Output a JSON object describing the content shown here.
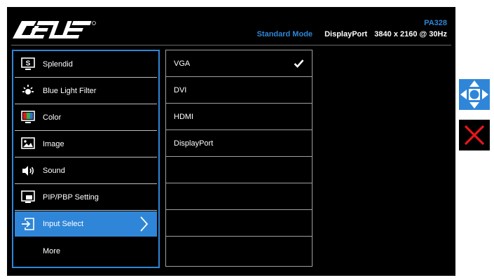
{
  "header": {
    "brand": "ASUS",
    "model": "PA328",
    "mode": "Standard Mode",
    "input": "DisplayPort",
    "resolution": "3840 x 2160 @ 30Hz"
  },
  "menu": {
    "items": [
      {
        "label": "Splendid",
        "icon": "splendid-icon"
      },
      {
        "label": "Blue Light Filter",
        "icon": "blue-light-filter-icon"
      },
      {
        "label": "Color",
        "icon": "color-icon"
      },
      {
        "label": "Image",
        "icon": "image-icon"
      },
      {
        "label": "Sound",
        "icon": "sound-icon"
      },
      {
        "label": "PIP/PBP Setting",
        "icon": "pip-pbp-icon"
      },
      {
        "label": "Input Select",
        "icon": "input-select-icon",
        "selected": true
      },
      {
        "label": "More",
        "icon": ""
      }
    ]
  },
  "submenu": {
    "items": [
      {
        "label": "VGA",
        "checked": true
      },
      {
        "label": "DVI"
      },
      {
        "label": "HDMI"
      },
      {
        "label": "DisplayPort"
      },
      {
        "label": ""
      },
      {
        "label": ""
      },
      {
        "label": ""
      },
      {
        "label": ""
      }
    ]
  },
  "side_controls": {
    "joystick_icon": "five-way-joystick-icon",
    "close_icon": "close-icon"
  },
  "colors": {
    "accent": "#2f86d8",
    "background": "#000000",
    "close": "#e8161b"
  }
}
